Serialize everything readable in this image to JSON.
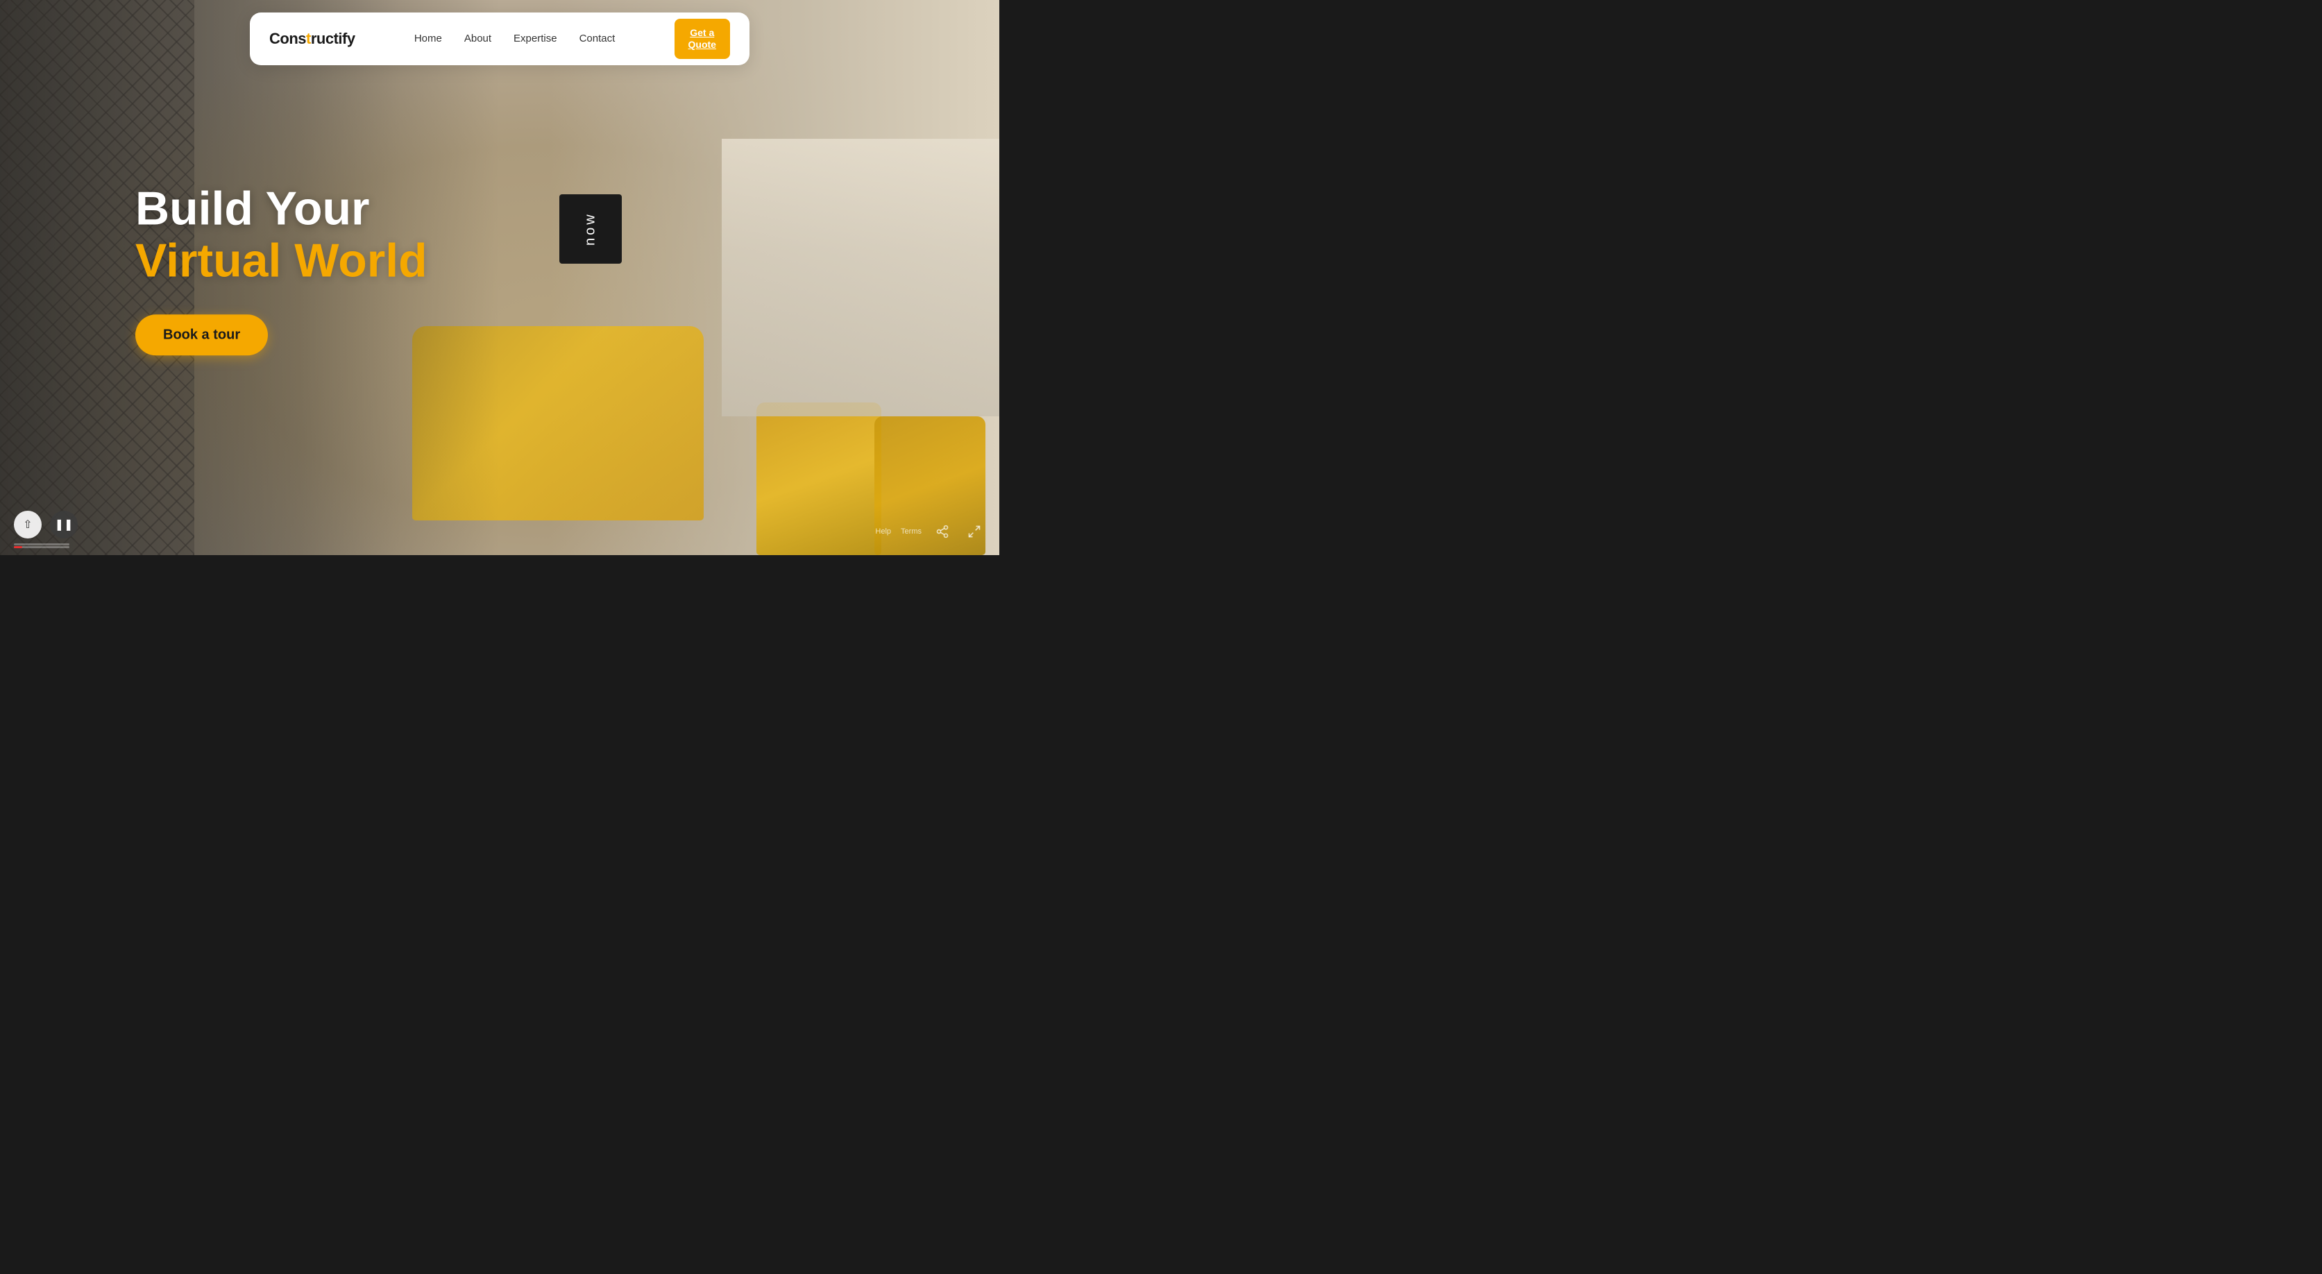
{
  "navbar": {
    "logo": {
      "part1": "Cons",
      "part2": "t",
      "part3": "ructify"
    },
    "nav_items": [
      {
        "label": "Home",
        "href": "#"
      },
      {
        "label": "About",
        "href": "#"
      },
      {
        "label": "Expertise",
        "href": "#"
      },
      {
        "label": "Contact",
        "href": "#"
      }
    ],
    "cta_label": "Get a\nQuote"
  },
  "hero": {
    "title_line1": "Build Your",
    "title_line2": "Virtual World",
    "cta_button": "Book a tour"
  },
  "bottom": {
    "help_text": "Help",
    "terms_text": "Terms"
  },
  "wall_art": "now"
}
